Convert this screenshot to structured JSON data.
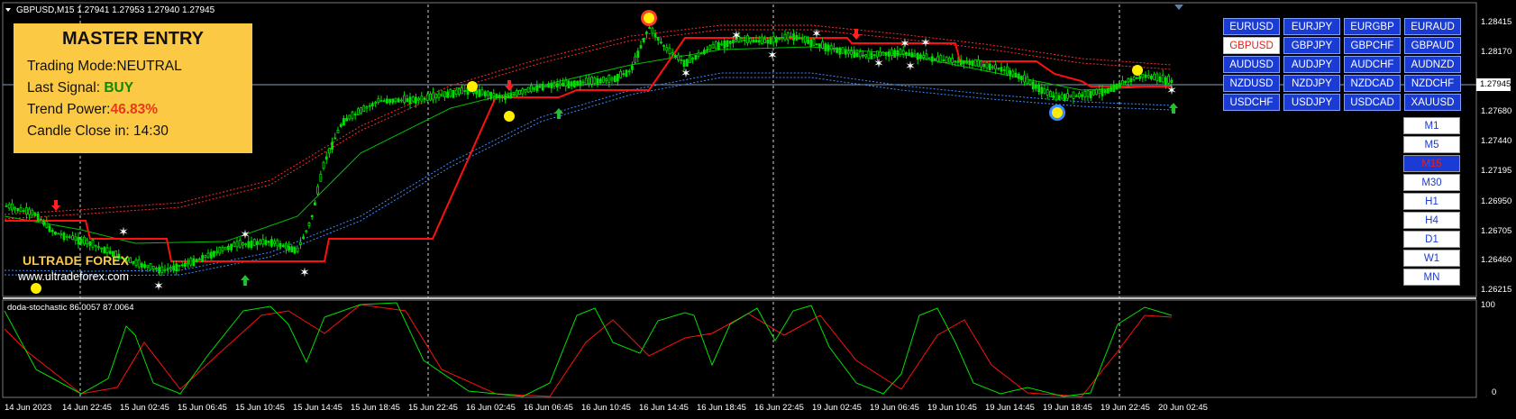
{
  "header": {
    "symbol_info": "GBPUSD,M15  1.27941  1.27953  1.27940  1.27945",
    "indicator_label": "doda-stochastic 86.0057 87.0064"
  },
  "panel": {
    "title": "MASTER ENTRY",
    "mode_label": "Trading Mode:",
    "mode_value": "NEUTRAL",
    "signal_label": "Last Signal:",
    "signal_value": "BUY",
    "power_label": "Trend Power:",
    "power_value": "46.83%",
    "candle_label": "Candle Close in:",
    "candle_value": "14:30"
  },
  "brand": {
    "name": "ULTRADE FOREX",
    "url": "www.ultradeforex.com"
  },
  "pairs": [
    "EURUSD",
    "EURJPY",
    "EURGBP",
    "EURAUD",
    "GBPUSD",
    "GBPJPY",
    "GBPCHF",
    "GBPAUD",
    "AUDUSD",
    "AUDJPY",
    "AUDCHF",
    "AUDNZD",
    "NZDUSD",
    "NZDJPY",
    "NZDCAD",
    "NZDCHF",
    "USDCHF",
    "USDJPY",
    "USDCAD",
    "XAUUSD"
  ],
  "active_pair": "GBPUSD",
  "timeframes": [
    "M1",
    "M5",
    "M15",
    "M30",
    "H1",
    "H4",
    "D1",
    "W1",
    "MN"
  ],
  "active_timeframe": "M15",
  "price_axis": [
    "1.28415",
    "1.28170",
    "1.27945",
    "1.27680",
    "1.27440",
    "1.27195",
    "1.26950",
    "1.26705",
    "1.26460",
    "1.26215"
  ],
  "current_price": "1.27945",
  "sub_axis": [
    "100",
    "0"
  ],
  "time_axis": [
    "14 Jun 2023",
    "14 Jun 22:45",
    "15 Jun 02:45",
    "15 Jun 06:45",
    "15 Jun 10:45",
    "15 Jun 14:45",
    "15 Jun 18:45",
    "15 Jun 22:45",
    "16 Jun 02:45",
    "16 Jun 06:45",
    "16 Jun 10:45",
    "16 Jun 14:45",
    "16 Jun 18:45",
    "16 Jun 22:45",
    "19 Jun 02:45",
    "19 Jun 06:45",
    "19 Jun 10:45",
    "19 Jun 14:45",
    "19 Jun 18:45",
    "19 Jun 22:45",
    "20 Jun 02:45"
  ],
  "colors": {
    "panel_bg": "#fcc944",
    "bull": "#00e000",
    "bear": "#ff1010",
    "upper_band": "#ff3030",
    "lower_band": "#3a8cff",
    "pair_button": "#1a3cd4",
    "signal_line": "#00e000"
  }
}
